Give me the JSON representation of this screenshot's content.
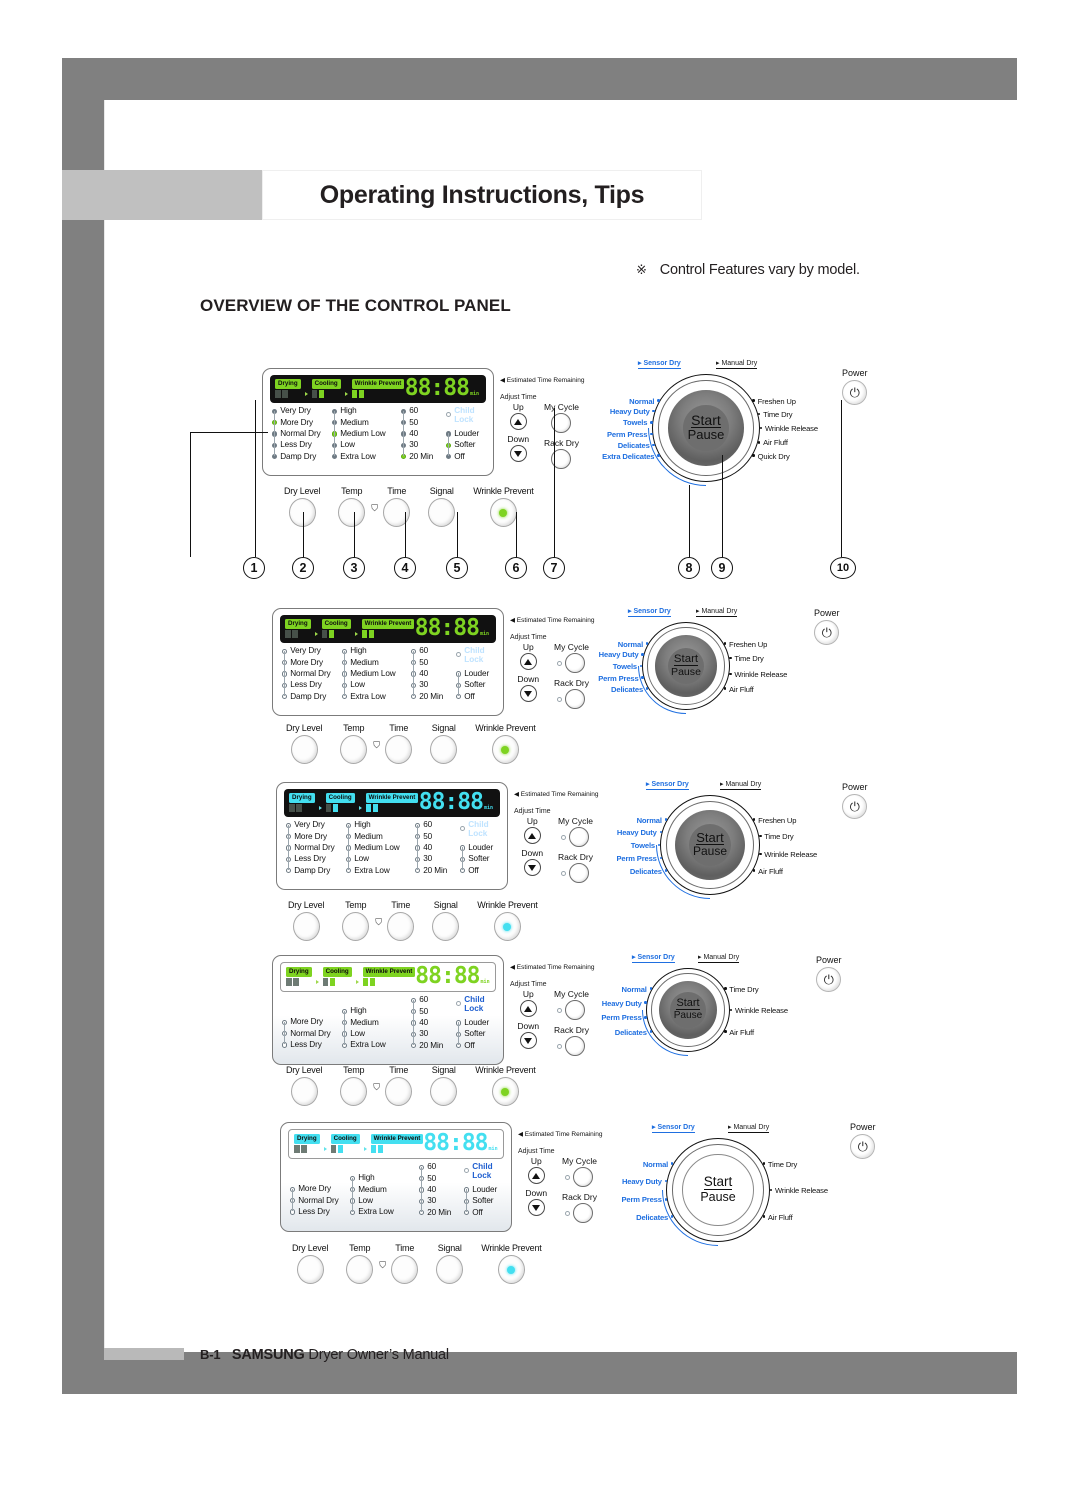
{
  "page": {
    "title": "Operating Instructions, Tips",
    "note_symbol": "※",
    "note_text": "Control Features vary by model.",
    "section_title": "OVERVIEW OF THE CONTROL PANEL",
    "footer_page": "B-1",
    "footer_brand": "SAMSUNG",
    "footer_rest": " Dryer Owner’s Manual"
  },
  "common": {
    "phases": [
      "Drying",
      "Cooling",
      "Wrinkle Prevent"
    ],
    "display_value": "88:88",
    "display_unit": "min",
    "estimated_label": "Estimated Time Remaining",
    "adjust_time_label": "Adjust Time",
    "up_label": "Up",
    "down_label": "Down",
    "my_cycle_label": "My Cycle",
    "rack_dry_label": "Rack Dry",
    "child_lock_label": "Child Lock",
    "power_label": "Power",
    "power_icon": "power-icon",
    "start_label": "Start",
    "pause_label": "Pause",
    "sensor_dry_label": "Sensor Dry",
    "manual_dry_label": "Manual Dry",
    "buttons": [
      "Dry Level",
      "Temp",
      "Time",
      "Signal",
      "Wrinkle Prevent"
    ],
    "colors": {
      "led_green": "#7ed321",
      "led_cyan": "#43dff0",
      "blue_text": "#1f6fe0",
      "frame_gray": "#808080",
      "tab_gray": "#c0c0c0"
    }
  },
  "callouts": [
    {
      "n": "1",
      "target": "dry-level-indicators"
    },
    {
      "n": "2",
      "target": "dry-level-button"
    },
    {
      "n": "3",
      "target": "temp-button"
    },
    {
      "n": "4",
      "target": "time-button"
    },
    {
      "n": "5",
      "target": "signal-button"
    },
    {
      "n": "6",
      "target": "wrinkle-prevent-button"
    },
    {
      "n": "7",
      "target": "child-lock"
    },
    {
      "n": "8",
      "target": "cycle-selector-dial"
    },
    {
      "n": "9",
      "target": "start-pause-button"
    },
    {
      "n": "10",
      "target": "power-button"
    }
  ],
  "panels": [
    {
      "id": "panel-1",
      "lcd_theme": "dark",
      "led_color": "green",
      "dry_level": [
        "Very Dry",
        "More Dry",
        "Normal Dry",
        "Less Dry",
        "Damp Dry"
      ],
      "dry_level_selected": 1,
      "temp": [
        "High",
        "Medium",
        "Medium Low",
        "Low",
        "Extra Low"
      ],
      "temp_selected": 2,
      "time": [
        "60",
        "50",
        "40",
        "30",
        "20 Min"
      ],
      "time_selected": 4,
      "signal": [
        "Louder",
        "Softer",
        "Off"
      ],
      "signal_selected": 1,
      "dots": "filled",
      "has_mini_dots": false,
      "sensor_dry": [
        "Normal",
        "Heavy Duty",
        "Towels",
        "Perm Press",
        "Delicates",
        "Extra Delicates"
      ],
      "manual_dry": [
        "Freshen Up",
        "Time Dry",
        "Wrinkle Release",
        "Air Fluff",
        "Quick Dry"
      ],
      "dial_hub": "dark",
      "wrinkle_led": "green"
    },
    {
      "id": "panel-2",
      "lcd_theme": "dark",
      "led_color": "green",
      "dry_level": [
        "Very Dry",
        "More Dry",
        "Normal Dry",
        "Less Dry",
        "Damp Dry"
      ],
      "dry_level_selected": -1,
      "temp": [
        "High",
        "Medium",
        "Medium Low",
        "Low",
        "Extra Low"
      ],
      "temp_selected": -1,
      "time": [
        "60",
        "50",
        "40",
        "30",
        "20 Min"
      ],
      "time_selected": -1,
      "signal": [
        "Louder",
        "Softer",
        "Off"
      ],
      "signal_selected": -1,
      "dots": "hollow",
      "has_mini_dots": true,
      "sensor_dry": [
        "Normal",
        "Heavy Duty",
        "Towels",
        "Perm Press",
        "Delicates"
      ],
      "manual_dry": [
        "Freshen Up",
        "Time Dry",
        "Wrinkle Release",
        "Air Fluff"
      ],
      "dial_hub": "dark",
      "wrinkle_led": "green"
    },
    {
      "id": "panel-3",
      "lcd_theme": "dark",
      "led_color": "cyan",
      "dry_level": [
        "Very Dry",
        "More Dry",
        "Normal Dry",
        "Less Dry",
        "Damp Dry"
      ],
      "dry_level_selected": -1,
      "temp": [
        "High",
        "Medium",
        "Medium Low",
        "Low",
        "Extra Low"
      ],
      "temp_selected": -1,
      "time": [
        "60",
        "50",
        "40",
        "30",
        "20 Min"
      ],
      "time_selected": -1,
      "signal": [
        "Louder",
        "Softer",
        "Off"
      ],
      "signal_selected": -1,
      "dots": "hollow",
      "has_mini_dots": true,
      "sensor_dry": [
        "Normal",
        "Heavy Duty",
        "Towels",
        "Perm Press",
        "Delicates"
      ],
      "manual_dry": [
        "Freshen Up",
        "Time Dry",
        "Wrinkle Release",
        "Air Fluff"
      ],
      "dial_hub": "dark",
      "wrinkle_led": "cyan"
    },
    {
      "id": "panel-4",
      "lcd_theme": "light",
      "led_color": "green",
      "dry_level": [
        "More Dry",
        "Normal Dry",
        "Less Dry"
      ],
      "dry_level_selected": -1,
      "temp": [
        "High",
        "Medium",
        "Low",
        "Extra Low"
      ],
      "temp_selected": -1,
      "time": [
        "60",
        "50",
        "40",
        "30",
        "20 Min"
      ],
      "time_selected": -1,
      "signal": [
        "Louder",
        "Softer",
        "Off"
      ],
      "signal_selected": -1,
      "dots": "hollow",
      "has_mini_dots": true,
      "sensor_dry": [
        "Normal",
        "Heavy Duty",
        "Perm Press",
        "Delicates"
      ],
      "manual_dry": [
        "Time Dry",
        "Wrinkle Release",
        "Air Fluff"
      ],
      "dial_hub": "dark",
      "wrinkle_led": "green"
    },
    {
      "id": "panel-5",
      "lcd_theme": "light",
      "led_color": "cyan",
      "dry_level": [
        "More Dry",
        "Normal Dry",
        "Less Dry"
      ],
      "dry_level_selected": -1,
      "temp": [
        "High",
        "Medium",
        "Low",
        "Extra Low"
      ],
      "temp_selected": -1,
      "time": [
        "60",
        "50",
        "40",
        "30",
        "20 Min"
      ],
      "time_selected": -1,
      "signal": [
        "Louder",
        "Softer",
        "Off"
      ],
      "signal_selected": -1,
      "dots": "hollow",
      "has_mini_dots": true,
      "sensor_dry": [
        "Normal",
        "Heavy Duty",
        "Perm Press",
        "Delicates"
      ],
      "manual_dry": [
        "Time Dry",
        "Wrinkle Release",
        "Air Fluff"
      ],
      "dial_hub": "white",
      "wrinkle_led": "cyan"
    }
  ]
}
